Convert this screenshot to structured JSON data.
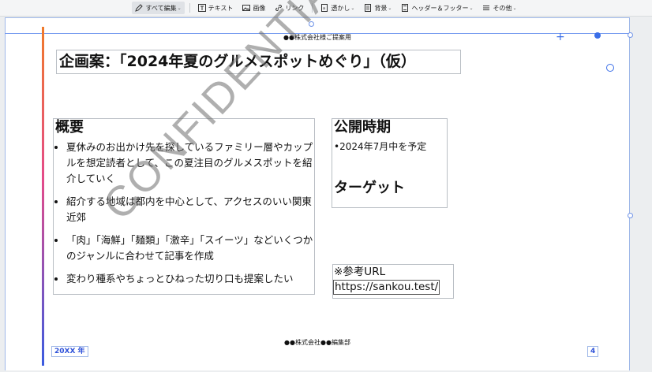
{
  "toolbar": {
    "items": [
      {
        "label": "すべて編集",
        "icon": "pencil-icon",
        "dropdown": true
      },
      {
        "label": "テキスト",
        "icon": "text-icon"
      },
      {
        "label": "画像",
        "icon": "image-icon"
      },
      {
        "label": "リンク",
        "icon": "link-icon"
      },
      {
        "label": "透かし",
        "icon": "watermark-icon",
        "dropdown": true
      },
      {
        "label": "背景",
        "icon": "background-icon",
        "dropdown": true
      },
      {
        "label": "ヘッダー＆フッター",
        "icon": "header-footer-icon",
        "dropdown": true
      },
      {
        "label": "その他",
        "icon": "more-icon",
        "dropdown": true
      }
    ]
  },
  "page": {
    "header": "●●株式会社様ご提案用",
    "title": "企画案：「2024年夏のグルメスポットめぐり」（仮）",
    "overview": {
      "heading": "概要",
      "bullets": [
        "夏休みのお出かけ先を探しているファミリー層やカップルを想定読者として、この夏注目のグルメスポットを紹介していく",
        "紹介する地域は都内を中心として、アクセスのいい関東近郊",
        "「肉」「海鮮」「麺類」「激辛」「スイーツ」などいくつかのジャンルに合わせて記事を作成",
        "変わり種系やちょっとひねった切り口も提案したい"
      ]
    },
    "period": {
      "heading": "公開時期",
      "bullet": "•2024年7月中を予定",
      "target_heading": "ターゲット"
    },
    "reference": {
      "label": "※参考URL",
      "url": "https://sankou.test/"
    },
    "watermark": "CONFIDENTIAL",
    "footer_center": "●●株式会社●●編集部",
    "footer_left": "20XX 年",
    "page_number": "4"
  },
  "colors": {
    "accent_gradient": [
      "#f07a2a",
      "#e44b8a",
      "#3a5be0"
    ],
    "selection": "#3a6ee8",
    "footer_text": "#2f52d9"
  }
}
